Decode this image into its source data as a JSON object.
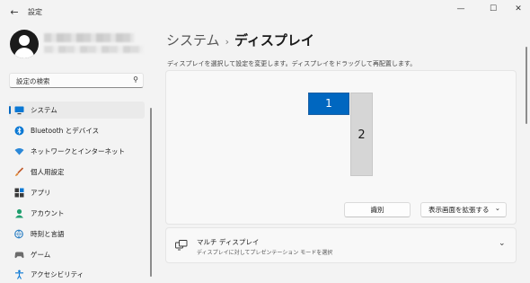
{
  "window": {
    "title": "設定",
    "back_glyph": "←",
    "minimize_glyph": "—",
    "maximize_glyph": "☐",
    "close_glyph": "✕"
  },
  "user": {
    "avatar": "person-icon"
  },
  "search": {
    "placeholder": "設定の検索",
    "icon": "search-icon"
  },
  "sidebar": {
    "items": [
      {
        "label": "システム",
        "icon": "display-icon",
        "selected": true
      },
      {
        "label": "Bluetooth とデバイス",
        "icon": "bluetooth-icon"
      },
      {
        "label": "ネットワークとインターネット",
        "icon": "wifi-icon"
      },
      {
        "label": "個人用設定",
        "icon": "brush-icon"
      },
      {
        "label": "アプリ",
        "icon": "apps-icon"
      },
      {
        "label": "アカウント",
        "icon": "account-icon"
      },
      {
        "label": "時刻と言語",
        "icon": "globe-clock-icon"
      },
      {
        "label": "ゲーム",
        "icon": "gamepad-icon"
      },
      {
        "label": "アクセシビリティ",
        "icon": "accessibility-icon"
      }
    ]
  },
  "breadcrumb": {
    "parent": "システム",
    "separator": "›",
    "current": "ディスプレイ"
  },
  "display_arrangement": {
    "description": "ディスプレイを選択して設定を変更します。ディスプレイをドラッグして再配置します。",
    "monitors": [
      {
        "label": "1",
        "selected": true
      },
      {
        "label": "2",
        "selected": false
      }
    ],
    "identify_label": "識別",
    "mode_dropdown": {
      "value": "表示画面を拡張する",
      "chevron": "⌄"
    }
  },
  "multi_display": {
    "title": "マルチ ディスプレイ",
    "subtitle": "ディスプレイに対してプレゼンテーション モードを選択",
    "chevron": "⌄",
    "icon": "multi-monitor-icon"
  },
  "colors": {
    "accent": "#0067c0",
    "background": "#f3f3f3",
    "card": "#f8f8f8"
  }
}
